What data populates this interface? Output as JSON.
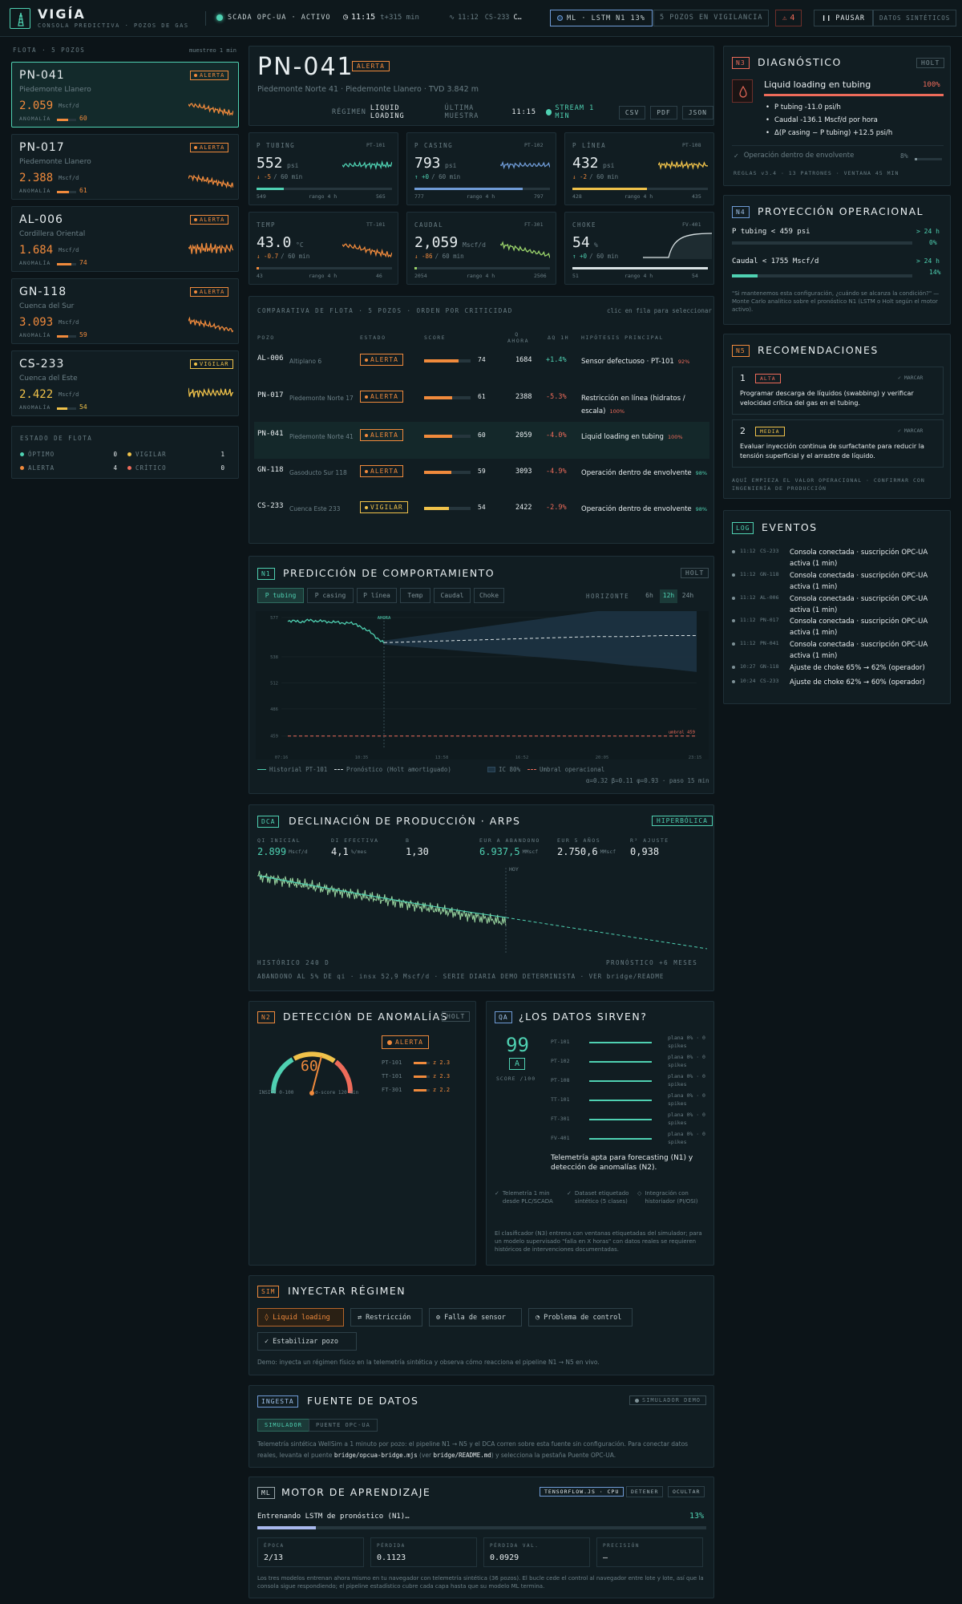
{
  "topbar": {
    "brand": "VIGÍA",
    "subtitle": "CONSOLA PREDICTIVA · POZOS DE GAS",
    "scada": "SCADA OPC-UA · ACTIVO",
    "time": "11:15",
    "offset": "t+315 min",
    "last_time": "11:12",
    "last_well": "CS-233",
    "last_text": "C…",
    "ml": "ML · LSTM N1 13%",
    "wells_watch": "5 POZOS EN VIGILANCIA",
    "alerts": "4",
    "pause": "PAUSAR",
    "synthetic": "DATOS SINTÉTICOS"
  },
  "fleet": {
    "title": "FLOTA · 5 POZOS",
    "note": "muestreo 1 min",
    "wells": [
      {
        "id": "PN-041",
        "region": "Piedemonte Llanero",
        "status": "ALERTA",
        "value": "2.059",
        "unit": "Mscf/d",
        "anom_label": "ANOMALÍA",
        "score": "60",
        "score_pct": 60,
        "color": "#f08a3c"
      },
      {
        "id": "PN-017",
        "region": "Piedemonte Llanero",
        "status": "ALERTA",
        "value": "2.388",
        "unit": "Mscf/d",
        "anom_label": "ANOMALÍA",
        "score": "61",
        "score_pct": 61,
        "color": "#f08a3c"
      },
      {
        "id": "AL-006",
        "region": "Cordillera Oriental",
        "status": "ALERTA",
        "value": "1.684",
        "unit": "Mscf/d",
        "anom_label": "ANOMALÍA",
        "score": "74",
        "score_pct": 74,
        "color": "#f08a3c"
      },
      {
        "id": "GN-118",
        "region": "Cuenca del Sur",
        "status": "ALERTA",
        "value": "3.093",
        "unit": "Mscf/d",
        "anom_label": "ANOMALÍA",
        "score": "59",
        "score_pct": 59,
        "color": "#f08a3c"
      },
      {
        "id": "CS-233",
        "region": "Cuenca del Este",
        "status": "VIGILAR",
        "value": "2.422",
        "unit": "Mscf/d",
        "anom_label": "ANOMALÍA",
        "score": "54",
        "score_pct": 54,
        "color": "#f0c24a"
      }
    ],
    "state_title": "ESTADO DE FLOTA",
    "states": [
      {
        "label": "ÓPTIMO",
        "count": "0",
        "color": "#4fd1b2"
      },
      {
        "label": "VIGILAR",
        "count": "1",
        "color": "#f0c24a"
      },
      {
        "label": "ALERTA",
        "count": "4",
        "color": "#f08a3c"
      },
      {
        "label": "CRÍTICO",
        "count": "0",
        "color": "#ee6b5a"
      }
    ]
  },
  "well": {
    "id": "PN-041",
    "status": "ALERTA",
    "location": "Piedemonte Norte 41 · Piedemonte Llanero · TVD 3.842 m",
    "regime_label": "RÉGIMEN",
    "regime": "LIQUID LOADING",
    "sample_label": "ÚLTIMA MUESTRA",
    "sample": "11:15",
    "stream": "STREAM 1 MIN",
    "csv": "CSV",
    "pdf": "PDF",
    "json": "JSON"
  },
  "sensors": [
    {
      "name": "P TUBING",
      "tag": "PT-101",
      "value": "552",
      "unit": "psi",
      "delta": "↓ -5",
      "delta_unit": "/ 60 min",
      "min": "549",
      "range": "rango 4 h",
      "max": "565",
      "color": "#4fd1b2",
      "fill": 0.2
    },
    {
      "name": "P CASING",
      "tag": "PT-102",
      "value": "793",
      "unit": "psi",
      "delta": "↑ +0",
      "delta_unit": "/ 60 min",
      "min": "777",
      "range": "rango 4 h",
      "max": "797",
      "color": "#6f9bd6",
      "fill": 0.8
    },
    {
      "name": "P LÍNEA",
      "tag": "PT-108",
      "value": "432",
      "unit": "psi",
      "delta": "↓ -2",
      "delta_unit": "/ 60 min",
      "min": "428",
      "range": "rango 4 h",
      "max": "435",
      "color": "#f0c24a",
      "fill": 0.55
    },
    {
      "name": "TEMP",
      "tag": "TT-101",
      "value": "43.0",
      "unit": "°C",
      "delta": "↓ -0.7",
      "delta_unit": "/ 60 min",
      "min": "43",
      "range": "rango 4 h",
      "max": "46",
      "color": "#f08a3c",
      "fill": 0.02
    },
    {
      "name": "CAUDAL",
      "tag": "FT-301",
      "value": "2,059",
      "unit": "Mscf/d",
      "delta": "↓ -86",
      "delta_unit": "/ 60 min",
      "min": "2054",
      "range": "rango 4 h",
      "max": "2506",
      "color": "#9ad36a",
      "fill": 0.02
    },
    {
      "name": "CHOKE",
      "tag": "FV-401",
      "value": "54",
      "unit": "%",
      "delta": "↑ +0",
      "delta_unit": "/ 60 min",
      "min": "51",
      "range": "rango 4 h",
      "max": "54",
      "color": "#d9e2e4",
      "fill": 1.0
    }
  ],
  "compare": {
    "title": "COMPARATIVA DE FLOTA · 5 POZOS · ORDEN POR CRITICIDAD",
    "hint": "clic en fila para seleccionar",
    "headers": [
      "POZO",
      "ESTADO",
      "SCORE",
      "Q AHORA",
      "ΔQ 1H",
      "HIPÓTESIS PRINCIPAL"
    ],
    "rows": [
      {
        "id": "AL-006",
        "loc": "Altiplano 6",
        "status": "ALERTA",
        "score": "74",
        "score_pct": 74,
        "q": "1684",
        "dq": "+1.4%",
        "hyp": "Sensor defectuoso · PT-101",
        "conf": "92%"
      },
      {
        "id": "PN-017",
        "loc": "Piedemonte Norte 17",
        "status": "ALERTA",
        "score": "61",
        "score_pct": 61,
        "q": "2388",
        "dq": "-5.3%",
        "hyp": "Restricción en línea (hidratos / escala)",
        "conf": "100%"
      },
      {
        "id": "PN-041",
        "loc": "Piedemonte Norte 41",
        "status": "ALERTA",
        "score": "60",
        "score_pct": 60,
        "q": "2059",
        "dq": "-4.0%",
        "hyp": "Liquid loading en tubing",
        "conf": "100%"
      },
      {
        "id": "GN-118",
        "loc": "Gasoducto Sur 118",
        "status": "ALERTA",
        "score": "59",
        "score_pct": 59,
        "q": "3093",
        "dq": "-4.9%",
        "hyp": "Operación dentro de envolvente",
        "conf": "98%"
      },
      {
        "id": "CS-233",
        "loc": "Cuenca Este 233",
        "status": "VIGILAR",
        "score": "54",
        "score_pct": 54,
        "q": "2422",
        "dq": "-2.9%",
        "hyp": "Operación dentro de envolvente",
        "conf": "98%"
      }
    ]
  },
  "prediction": {
    "tag": "N1",
    "title": "PREDICCIÓN DE COMPORTAMIENTO",
    "model": "HOLT",
    "tabs": [
      "P tubing",
      "P casing",
      "P línea",
      "Temp",
      "Caudal",
      "Choke"
    ],
    "horizon_label": "HORIZONTE",
    "horizons": [
      "6h",
      "12h",
      "24h"
    ],
    "now_label": "AHORA",
    "threshold_label": "umbral 459",
    "yticks": [
      "577",
      "538",
      "512",
      "486",
      "459"
    ],
    "xticks": [
      "07:16",
      "10:35",
      "13:58",
      "16:52",
      "20:05",
      "23:15"
    ],
    "legend": [
      "Historial PT-101",
      "Pronóstico (Holt amortiguado)",
      "IC 80%",
      "Umbral operacional"
    ],
    "params": "α=0.32 β=0.11 φ=0.93 · paso 15 min"
  },
  "chart_data": {
    "type": "line",
    "series": [
      {
        "name": "Historial PT-101",
        "values": [
          573,
          574,
          572,
          575,
          573,
          574,
          572,
          573,
          571,
          572,
          570,
          566,
          563,
          556,
          552
        ]
      },
      {
        "name": "Pronóstico (Holt amortiguado)",
        "values": [
          552,
          553,
          554,
          555,
          556,
          557,
          558,
          558,
          559,
          559
        ]
      }
    ],
    "threshold": 459,
    "ylim": [
      446,
      577
    ]
  },
  "diagnosis": {
    "tag": "N3",
    "title": "DIAGNÓSTICO",
    "model": "HOLT",
    "main": "Liquid loading en tubing",
    "main_pct": "100%",
    "bullets": [
      "P tubing -11.0 psi/h",
      "Caudal -136.1 Mscf/d por hora",
      "Δ(P casing − P tubing) +12.5 psi/h"
    ],
    "secondary": "Operación dentro de envolvente",
    "secondary_pct": "8%",
    "footer": "REGLAS v3.4 · 13 PATRONES · VENTANA 45 MIN"
  },
  "projection": {
    "tag": "N4",
    "title": "PROYECCIÓN OPERACIONAL",
    "items": [
      {
        "label": "P tubing < 459 psi",
        "eta": "> 24 h",
        "pct": "0%",
        "fill": 0
      },
      {
        "label": "Caudal < 1755 Mscf/d",
        "eta": "> 24 h",
        "pct": "14%",
        "fill": 14
      }
    ],
    "note": "\"Si mantenemos esta configuración, ¿cuándo se alcanza la condición?\" — Monte Carlo analítico sobre el pronóstico N1 (LSTM o Holt según el motor activo)."
  },
  "recommendations": {
    "tag": "N5",
    "title": "RECOMENDACIONES",
    "items": [
      {
        "n": "1",
        "priority": "ALTA",
        "mark": "✓ MARCAR",
        "text": "Programar descarga de líquidos (swabbing) y verificar velocidad crítica del gas en el tubing."
      },
      {
        "n": "2",
        "priority": "MEDIA",
        "mark": "✓ MARCAR",
        "text": "Evaluar inyección continua de surfactante para reducir la tensión superficial y el arrastre de líquido."
      }
    ],
    "footer": "AQUÍ EMPIEZA EL VALOR OPERACIONAL · CONFIRMAR CON INGENIERÍA DE PRODUCCIÓN"
  },
  "events": {
    "tag": "LOG",
    "title": "EVENTOS",
    "items": [
      {
        "time": "11:12",
        "well": "CS-233",
        "text": "Consola conectada · suscripción OPC-UA activa (1 min)"
      },
      {
        "time": "11:12",
        "well": "GN-118",
        "text": "Consola conectada · suscripción OPC-UA activa (1 min)"
      },
      {
        "time": "11:12",
        "well": "AL-006",
        "text": "Consola conectada · suscripción OPC-UA activa (1 min)"
      },
      {
        "time": "11:12",
        "well": "PN-017",
        "text": "Consola conectada · suscripción OPC-UA activa (1 min)"
      },
      {
        "time": "11:12",
        "well": "PN-041",
        "text": "Consola conectada · suscripción OPC-UA activa (1 min)"
      },
      {
        "time": "10:27",
        "well": "GN-118",
        "text": "Ajuste de choke 65% → 62% (operador)"
      },
      {
        "time": "10:24",
        "well": "CS-233",
        "text": "Ajuste de choke 62% → 60% (operador)"
      }
    ]
  },
  "dca": {
    "tag": "DCA",
    "title": "DECLINACIÓN DE PRODUCCIÓN · ARPS",
    "badge": "HIPERBÓLICA",
    "stats": [
      {
        "label": "QI INICIAL",
        "value": "2.899",
        "unit": "Mscf/d"
      },
      {
        "label": "DI EFECTIVA",
        "value": "4,1",
        "unit": "%/mes"
      },
      {
        "label": "B",
        "value": "1,30",
        "unit": ""
      },
      {
        "label": "EUR A ABANDONO",
        "value": "6.937,5",
        "unit": "MMscf"
      },
      {
        "label": "EUR 5 AÑOS",
        "value": "2.750,6",
        "unit": "MMscf"
      },
      {
        "label": "R² AJUSTE",
        "value": "0,938",
        "unit": ""
      }
    ],
    "hoy": "HOY",
    "left": "HISTÓRICO 240 D",
    "right": "PRONÓSTICO +6 MESES",
    "footer": "ABANDONO AL 5% DE qi · insx 52,9 Mscf/d · SERIE DIARIA DEMO DETERMINISTA · VER bridge/README"
  },
  "anomaly": {
    "tag": "N2",
    "title": "DETECCIÓN DE ANOMALÍAS",
    "model": "HOLT",
    "score": "60",
    "status": "ALERTA",
    "left": "INSITE 0-100",
    "right": "σ-score 120 min",
    "sensors": [
      {
        "tag": "PT-101",
        "z": "z 2.3"
      },
      {
        "tag": "TT-101",
        "z": "z 2.3"
      },
      {
        "tag": "FT-301",
        "z": "z 2.2"
      }
    ]
  },
  "quality": {
    "tag": "QA",
    "title": "¿LOS DATOS SIRVEN?",
    "score": "99",
    "grade": "A",
    "score_label": "SCORE /100",
    "sensors": [
      {
        "tag": "PT-101",
        "note": "plana 0% · 0 spikes"
      },
      {
        "tag": "PT-102",
        "note": "plana 0% · 0 spikes"
      },
      {
        "tag": "PT-108",
        "note": "plana 0% · 0 spikes"
      },
      {
        "tag": "TT-101",
        "note": "plana 0% · 0 spikes"
      },
      {
        "tag": "FT-301",
        "note": "plana 0% · 0 spikes"
      },
      {
        "tag": "FV-401",
        "note": "plana 0% · 0 spikes"
      }
    ],
    "verdict": "Telemetría apta para forecasting (N1) y detección de anomalías (N2).",
    "checks": [
      "Telemetría 1 min desde PLC/SCADA",
      "Dataset etiquetado sintético (5 clases)",
      "Integración con historiador (PI/OSI)"
    ],
    "note": "El clasificador (N3) entrena con ventanas etiquetadas del simulador; para un modelo supervisado \"falla en X horas\" con datos reales se requieren históricos de intervenciones documentadas."
  },
  "simulate": {
    "tag": "SIM",
    "title": "INYECTAR RÉGIMEN",
    "buttons": [
      "Liquid loading",
      "Restricción",
      "Falla de sensor",
      "Problema de control",
      "Estabilizar pozo"
    ],
    "note": "Demo: inyecta un régimen físico en la telemetría sintética y observa cómo reacciona el pipeline N1 → N5 en vivo."
  },
  "ingest": {
    "tag": "INGESTA",
    "title": "FUENTE DE DATOS",
    "badge": "SIMULADOR DEMO",
    "tabs": [
      "SIMULADOR",
      "PUENTE OPC-UA"
    ],
    "note1": "Telemetría sintética WellSim a 1 minuto por pozo: el pipeline N1 → N5 y el DCA corren sobre esta fuente sin configuración. Para conectar datos reales, levanta el puente ",
    "code1": "bridge/opcua-bridge.mjs",
    "note2": " (ver ",
    "code2": "bridge/README.md",
    "note3": ") y selecciona la pestaña Puente OPC-UA."
  },
  "ml": {
    "tag": "ML",
    "title": "MOTOR DE APRENDIZAJE",
    "engine": "TENSORFLOW.JS · CPU",
    "stop": "DETENER",
    "hide": "OCULTAR",
    "training": "Entrenando LSTM de pronóstico (N1)…",
    "pct": "13%",
    "progress": 13,
    "stats": [
      {
        "label": "ÉPOCA",
        "value": "2/13"
      },
      {
        "label": "PÉRDIDA",
        "value": "0.1123"
      },
      {
        "label": "PÉRDIDA VAL.",
        "value": "0.0929"
      },
      {
        "label": "PRECISIÓN",
        "value": "—"
      }
    ],
    "note": "Los tres modelos entrenan ahora mismo en tu navegador con telemetría sintética (36 pozos). El bucle cede el control al navegador entre lote y lote, así que la consola sigue respondiendo; el pipeline estadístico cubre cada capa hasta que su modelo ML termina."
  }
}
